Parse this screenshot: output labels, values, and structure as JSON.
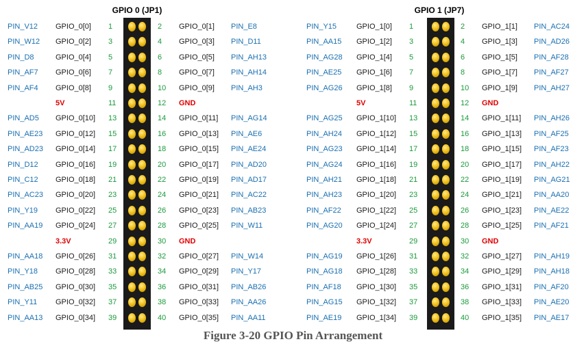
{
  "figure": {
    "caption": "Figure 3-20 GPIO Pin Arrangement",
    "colors": {
      "pin_name": "#1a6fb0",
      "gpio_label": "#1a1a1a",
      "pin_number": "#1a9a3a",
      "power": "#e00000",
      "connector_body": "#1a1a1a",
      "pin_gold": "#f2c21e"
    }
  },
  "headers": [
    {
      "title": "GPIO 0 (JP1)",
      "rows": [
        {
          "lp": "PIN_V12",
          "lg": "GPIO_0[0]",
          "ln": "1",
          "rn": "2",
          "rg": "GPIO_0[1]",
          "rp": "PIN_E8"
        },
        {
          "lp": "PIN_W12",
          "lg": "GPIO_0[2]",
          "ln": "3",
          "rn": "4",
          "rg": "GPIO_0[3]",
          "rp": "PIN_D11"
        },
        {
          "lp": "PIN_D8",
          "lg": "GPIO_0[4]",
          "ln": "5",
          "rn": "6",
          "rg": "GPIO_0[5]",
          "rp": "PIN_AH13"
        },
        {
          "lp": "PIN_AF7",
          "lg": "GPIO_0[6]",
          "ln": "7",
          "rn": "8",
          "rg": "GPIO_0[7]",
          "rp": "PIN_AH14"
        },
        {
          "lp": "PIN_AF4",
          "lg": "GPIO_0[8]",
          "ln": "9",
          "rn": "10",
          "rg": "GPIO_0[9]",
          "rp": "PIN_AH3"
        },
        {
          "lp": "",
          "lg": "5V",
          "ln": "11",
          "rn": "12",
          "rg": "GND",
          "rp": "",
          "power": true
        },
        {
          "lp": "PIN_AD5",
          "lg": "GPIO_0[10]",
          "ln": "13",
          "rn": "14",
          "rg": "GPIO_0[11]",
          "rp": "PIN_AG14"
        },
        {
          "lp": "PIN_AE23",
          "lg": "GPIO_0[12]",
          "ln": "15",
          "rn": "16",
          "rg": "GPIO_0[13]",
          "rp": "PIN_AE6"
        },
        {
          "lp": "PIN_AD23",
          "lg": "GPIO_0[14]",
          "ln": "17",
          "rn": "18",
          "rg": "GPIO_0[15]",
          "rp": "PIN_AE24"
        },
        {
          "lp": "PIN_D12",
          "lg": "GPIO_0[16]",
          "ln": "19",
          "rn": "20",
          "rg": "GPIO_0[17]",
          "rp": "PIN_AD20"
        },
        {
          "lp": "PIN_C12",
          "lg": "GPIO_0[18]",
          "ln": "21",
          "rn": "22",
          "rg": "GPIO_0[19]",
          "rp": "PIN_AD17"
        },
        {
          "lp": "PIN_AC23",
          "lg": "GPIO_0[20]",
          "ln": "23",
          "rn": "24",
          "rg": "GPIO_0[21]",
          "rp": "PIN_AC22"
        },
        {
          "lp": "PIN_Y19",
          "lg": "GPIO_0[22]",
          "ln": "25",
          "rn": "26",
          "rg": "GPIO_0[23]",
          "rp": "PIN_AB23"
        },
        {
          "lp": "PIN_AA19",
          "lg": "GPIO_0[24]",
          "ln": "27",
          "rn": "28",
          "rg": "GPIO_0[25]",
          "rp": "PIN_W11"
        },
        {
          "lp": "",
          "lg": "3.3V",
          "ln": "29",
          "rn": "30",
          "rg": "GND",
          "rp": "",
          "power": true
        },
        {
          "lp": "PIN_AA18",
          "lg": "GPIO_0[26]",
          "ln": "31",
          "rn": "32",
          "rg": "GPIO_0[27]",
          "rp": "PIN_W14"
        },
        {
          "lp": "PIN_Y18",
          "lg": "GPIO_0[28]",
          "ln": "33",
          "rn": "34",
          "rg": "GPIO_0[29]",
          "rp": "PIN_Y17"
        },
        {
          "lp": "PIN_AB25",
          "lg": "GPIO_0[30]",
          "ln": "35",
          "rn": "36",
          "rg": "GPIO_0[31]",
          "rp": "PIN_AB26"
        },
        {
          "lp": "PIN_Y11",
          "lg": "GPIO_0[32]",
          "ln": "37",
          "rn": "38",
          "rg": "GPIO_0[33]",
          "rp": "PIN_AA26"
        },
        {
          "lp": "PIN_AA13",
          "lg": "GPIO_0[34]",
          "ln": "39",
          "rn": "40",
          "rg": "GPIO_0[35]",
          "rp": "PIN_AA11"
        }
      ]
    },
    {
      "title": "GPIO 1 (JP7)",
      "rows": [
        {
          "lp": "PIN_Y15",
          "lg": "GPIO_1[0]",
          "ln": "1",
          "rn": "2",
          "rg": "GPIO_1[1]",
          "rp": "PIN_AC24"
        },
        {
          "lp": "PIN_AA15",
          "lg": "GPIO_1[2]",
          "ln": "3",
          "rn": "4",
          "rg": "GPIO_1[3]",
          "rp": "PIN_AD26"
        },
        {
          "lp": "PIN_AG28",
          "lg": "GPIO_1[4]",
          "ln": "5",
          "rn": "6",
          "rg": "GPIO_1[5]",
          "rp": "PIN_AF28"
        },
        {
          "lp": "PIN_AE25",
          "lg": "GPIO_1[6]",
          "ln": "7",
          "rn": "8",
          "rg": "GPIO_1[7]",
          "rp": "PIN_AF27"
        },
        {
          "lp": "PIN_AG26",
          "lg": "GPIO_1[8]",
          "ln": "9",
          "rn": "10",
          "rg": "GPIO_1[9]",
          "rp": "PIN_AH27"
        },
        {
          "lp": "",
          "lg": "5V",
          "ln": "11",
          "rn": "12",
          "rg": "GND",
          "rp": "",
          "power": true
        },
        {
          "lp": "PIN_AG25",
          "lg": "GPIO_1[10]",
          "ln": "13",
          "rn": "14",
          "rg": "GPIO_1[11]",
          "rp": "PIN_AH26"
        },
        {
          "lp": "PIN_AH24",
          "lg": "GPIO_1[12]",
          "ln": "15",
          "rn": "16",
          "rg": "GPIO_1[13]",
          "rp": "PIN_AF25"
        },
        {
          "lp": "PIN_AG23",
          "lg": "GPIO_1[14]",
          "ln": "17",
          "rn": "18",
          "rg": "GPIO_1[15]",
          "rp": "PIN_AF23"
        },
        {
          "lp": "PIN_AG24",
          "lg": "GPIO_1[16]",
          "ln": "19",
          "rn": "20",
          "rg": "GPIO_1[17]",
          "rp": "PIN_AH22"
        },
        {
          "lp": "PIN_AH21",
          "lg": "GPIO_1[18]",
          "ln": "21",
          "rn": "22",
          "rg": "GPIO_1[19]",
          "rp": "PIN_AG21"
        },
        {
          "lp": "PIN_AH23",
          "lg": "GPIO_1[20]",
          "ln": "23",
          "rn": "24",
          "rg": "GPIO_1[21]",
          "rp": "PIN_AA20"
        },
        {
          "lp": "PIN_AF22",
          "lg": "GPIO_1[22]",
          "ln": "25",
          "rn": "26",
          "rg": "GPIO_1[23]",
          "rp": "PIN_AE22"
        },
        {
          "lp": "PIN_AG20",
          "lg": "GPIO_1[24]",
          "ln": "27",
          "rn": "28",
          "rg": "GPIO_1[25]",
          "rp": "PIN_AF21"
        },
        {
          "lp": "",
          "lg": "3.3V",
          "ln": "29",
          "rn": "30",
          "rg": "GND",
          "rp": "",
          "power": true
        },
        {
          "lp": "PIN_AG19",
          "lg": "GPIO_1[26]",
          "ln": "31",
          "rn": "32",
          "rg": "GPIO_1[27]",
          "rp": "PIN_AH19"
        },
        {
          "lp": "PIN_AG18",
          "lg": "GPIO_1[28]",
          "ln": "33",
          "rn": "34",
          "rg": "GPIO_1[29]",
          "rp": "PIN_AH18"
        },
        {
          "lp": "PIN_AF18",
          "lg": "GPIO_1[30]",
          "ln": "35",
          "rn": "36",
          "rg": "GPIO_1[31]",
          "rp": "PIN_AF20"
        },
        {
          "lp": "PIN_AG15",
          "lg": "GPIO_1[32]",
          "ln": "37",
          "rn": "38",
          "rg": "GPIO_1[33]",
          "rp": "PIN_AE20"
        },
        {
          "lp": "PIN_AE19",
          "lg": "GPIO_1[34]",
          "ln": "39",
          "rn": "40",
          "rg": "GPIO_1[35]",
          "rp": "PIN_AE17"
        }
      ]
    }
  ]
}
